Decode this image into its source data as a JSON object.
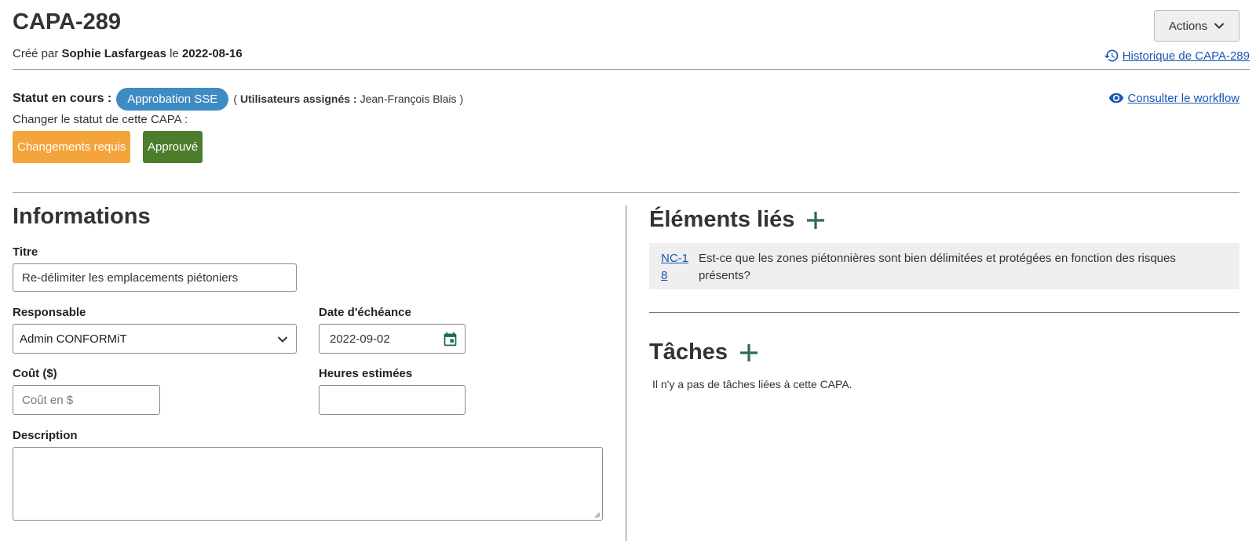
{
  "header": {
    "title": "CAPA-289",
    "created_prefix": "Créé par",
    "created_by": "Sophie Lasfargeas",
    "created_on_word": "le",
    "created_date": "2022-08-16",
    "actions_label": "Actions",
    "history_link": "Historique de CAPA-289"
  },
  "status": {
    "label": "Statut en cours :",
    "current": "Approbation SSE",
    "assigned_open": "(",
    "assigned_label": "Utilisateurs assignés :",
    "assigned_user": "Jean-François Blais",
    "assigned_close": ")",
    "workflow_link": "Consulter le workflow",
    "change_label": "Changer le statut de cette CAPA :",
    "btn_changes": "Changements requis",
    "btn_approve": "Approuvé",
    "colors": {
      "in_progress": "#3f8bc4",
      "changes": "#f3a43a",
      "approved": "#4c7d2a",
      "link": "#1a55b5",
      "add_icon": "#2e6b57"
    }
  },
  "informations": {
    "heading": "Informations",
    "titre_label": "Titre",
    "titre_value": "Re-délimiter les emplacements piétoniers",
    "responsable_label": "Responsable",
    "responsable_value": "Admin CONFORMiT",
    "date_label": "Date d'échéance",
    "date_value": "2022-09-02",
    "cout_label": "Coût ($)",
    "cout_placeholder": "Coût en $",
    "heures_label": "Heures estimées",
    "heures_value": "",
    "description_label": "Description",
    "description_value": ""
  },
  "linked": {
    "heading": "Éléments liés",
    "items": [
      {
        "id": "NC-18",
        "text": "Est-ce que les zones piétonnières sont bien délimitées et protégées en fonction des risques présents?"
      }
    ]
  },
  "tasks": {
    "heading": "Tâches",
    "empty_text": "Il n'y a pas de tâches liées à cette CAPA."
  },
  "icons": [
    "chevron-down-icon",
    "history-icon",
    "eye-icon",
    "plus-icon",
    "calendar-icon"
  ]
}
